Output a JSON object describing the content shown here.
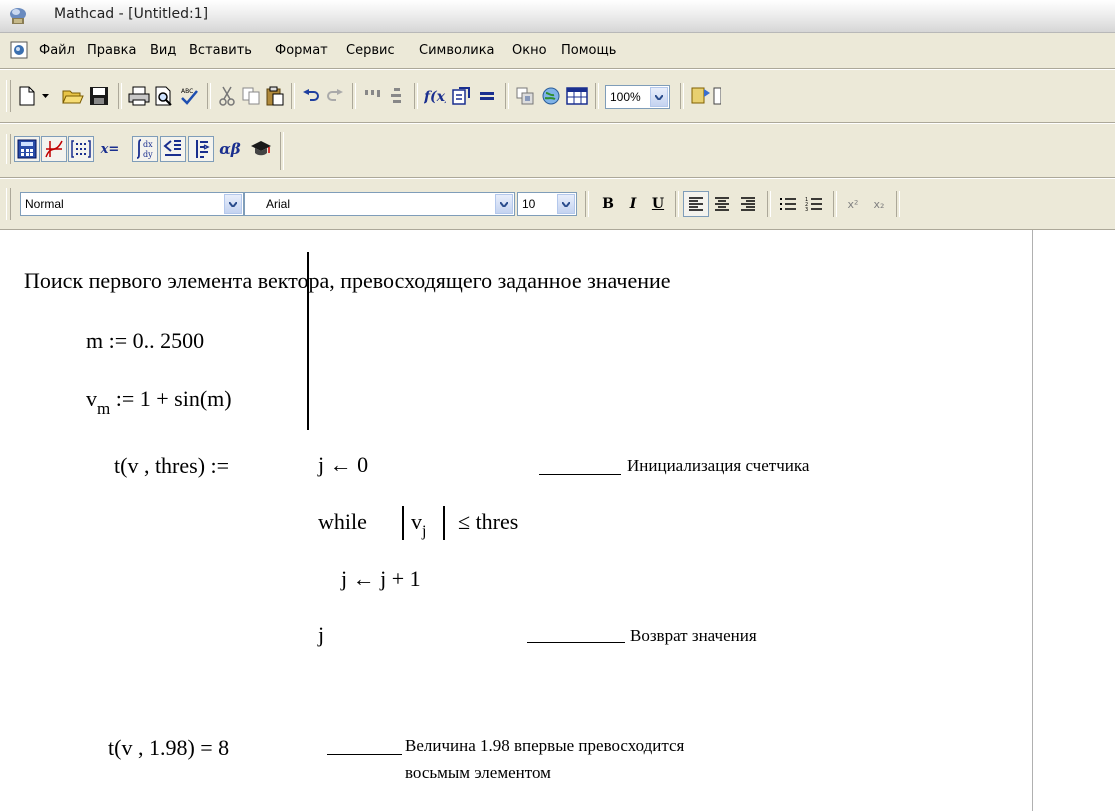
{
  "window": {
    "title": "Mathcad - [Untitled:1]"
  },
  "menu": [
    "Файл",
    "Правка",
    "Вид",
    "Вставить",
    "Формат",
    "Сервис",
    "Символика",
    "Окно",
    "Помощь"
  ],
  "toolbar_standard": {
    "zoom": "100%",
    "icons": [
      "new-document",
      "open",
      "save",
      "print",
      "print-preview",
      "spell-check",
      "cut",
      "copy",
      "paste",
      "undo",
      "redo",
      "align-across",
      "align-down",
      "insert-function",
      "insert-unit",
      "calculate",
      "component",
      "resource-center",
      "region",
      "zoom",
      "help"
    ]
  },
  "toolbar_math": {
    "buttons": [
      "calculator",
      "graph",
      "matrix",
      "evaluation",
      "calculus",
      "boolean",
      "programming",
      "greek",
      "symbolic"
    ],
    "evaluation_label": "x=",
    "greek_label": "αβ"
  },
  "toolbar_formatting": {
    "style": "Normal",
    "font": "Arial",
    "size": "10",
    "bold": "B",
    "italic": "I",
    "underline": "U",
    "superscript": "x²",
    "subscript": "x₂"
  },
  "worksheet": {
    "heading": "Поиск первого элемента вектора, превосходящего заданное значение",
    "range_def": "m := 0.. 2500",
    "vec_def_v": "v",
    "vec_def_sub": "m",
    "vec_def_rest": " := 1 + sin(m)",
    "func_head": "t(v , thres) :=",
    "prog_line1": "j ← 0",
    "prog_while_kw": "while",
    "prog_while_v": "v",
    "prog_while_sub": "j",
    "prog_while_rest": "≤ thres",
    "prog_line3": "j ← j + 1",
    "prog_line4": "j",
    "ann_init": "Инициализация счетчика",
    "ann_return": "Возврат значения",
    "eval": "t(v , 1.98) = 8",
    "ann_eval_1": "Величина 1.98 впервые превосходится",
    "ann_eval_2": "восьмым элементом"
  }
}
